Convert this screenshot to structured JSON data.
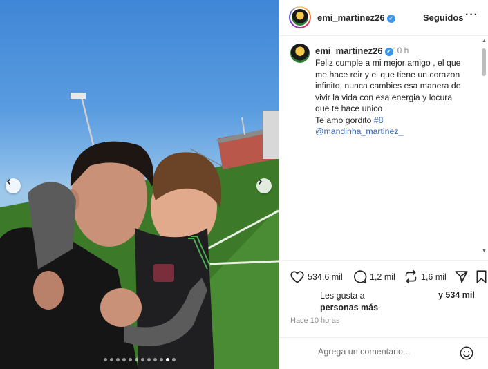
{
  "post": {
    "username": "emi_martinez26",
    "follow_status": "Seguidos",
    "more_label": "···",
    "time_ago": "10 h",
    "caption_lines": [
      "Feliz cumple a mi mejor amigo , el que",
      "me hace reir y el que tiene un corazon",
      "infinito, nunca cambies esa manera de",
      "vivir la vida con esa energia y locura",
      "que te hace unico",
      "Te amo gordito"
    ],
    "hashtag": "#8",
    "mention": "@mandinha_martinez_",
    "likes_count": "534,6 mil",
    "comments_count": "1,2 mil",
    "reposts_count": "1,6 mil",
    "liked_by_line1": "Les gusta a",
    "liked_by_line2": "personas más",
    "liked_by_count": "y 534 mil",
    "date_label": "Hace 10 horas",
    "comment_placeholder": "Agrega un comentario...",
    "carousel": {
      "total": 12,
      "active": 11
    }
  },
  "icons": {
    "verified": "verified-badge-icon",
    "like": "heart-icon",
    "comment": "comment-icon",
    "repost": "repost-icon",
    "share": "send-icon",
    "save": "bookmark-icon",
    "emoji": "emoji-icon",
    "prev": "chevron-left-icon",
    "next": "chevron-right-icon"
  },
  "colors": {
    "link": "#3866b8",
    "verified": "#3897f0",
    "secondary": "#8e8e8e"
  }
}
